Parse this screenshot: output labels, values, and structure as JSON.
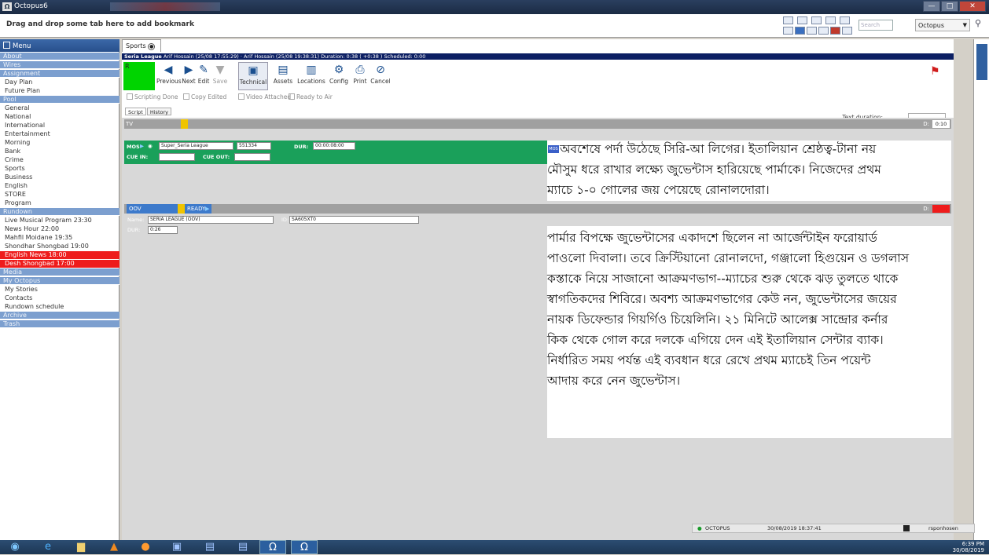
{
  "window": {
    "title": "Octopus6",
    "logo": "Ω",
    "minimize": "—",
    "maximize": "□",
    "close": "✕"
  },
  "bookmark_bar": {
    "hint": "Drag and drop some tab here to add bookmark",
    "search_placeholder": "Search",
    "site_select": "Octopus"
  },
  "sidebar": {
    "header": "Menu",
    "items": [
      {
        "label": "About",
        "kind": "sec"
      },
      {
        "label": "Wires",
        "kind": "sec"
      },
      {
        "label": "Assignment",
        "kind": "sec"
      },
      {
        "label": "Day Plan",
        "kind": "item"
      },
      {
        "label": "Future Plan",
        "kind": "item"
      },
      {
        "label": "Pool",
        "kind": "sec"
      },
      {
        "label": "General",
        "kind": "item"
      },
      {
        "label": "National",
        "kind": "item"
      },
      {
        "label": "International",
        "kind": "item"
      },
      {
        "label": "Entertainment",
        "kind": "item"
      },
      {
        "label": "Morning",
        "kind": "item"
      },
      {
        "label": "Bank",
        "kind": "item"
      },
      {
        "label": "Crime",
        "kind": "item"
      },
      {
        "label": "Sports",
        "kind": "item"
      },
      {
        "label": "Business",
        "kind": "item"
      },
      {
        "label": "English",
        "kind": "item"
      },
      {
        "label": "STORE",
        "kind": "item"
      },
      {
        "label": "Program",
        "kind": "item"
      },
      {
        "label": "Rundown",
        "kind": "sec"
      },
      {
        "label": "Live Musical Program 23:30",
        "kind": "item"
      },
      {
        "label": "News Hour 22:00",
        "kind": "item"
      },
      {
        "label": "Mahfil Moidane 19:35",
        "kind": "item"
      },
      {
        "label": "Shondhar Shongbad 19:00",
        "kind": "item"
      },
      {
        "label": "English News 18:00",
        "kind": "red"
      },
      {
        "label": "Desh Shongbad 17:00",
        "kind": "red"
      },
      {
        "label": "Media",
        "kind": "sec"
      },
      {
        "label": "My Octopus",
        "kind": "sec"
      },
      {
        "label": "My Stories",
        "kind": "item"
      },
      {
        "label": "Contacts",
        "kind": "item"
      },
      {
        "label": "Rundown schedule",
        "kind": "item"
      },
      {
        "label": "Archive",
        "kind": "sec"
      },
      {
        "label": "Trash",
        "kind": "sec"
      }
    ]
  },
  "tab": {
    "label": "Sports"
  },
  "story_info": {
    "title": "Seria League",
    "details": "Arif Hossain (25/08 17:55:29) · Arif Hossain (25/08 19:38:31) Duration: 0:38 ( +0:38 ) Scheduled: 0:00"
  },
  "toolbar": {
    "buttons": [
      {
        "label": "Previous",
        "icon": "◀",
        "state": "on"
      },
      {
        "label": "Next",
        "icon": "▶",
        "state": "on"
      },
      {
        "label": "Edit",
        "icon": "✎",
        "state": "on"
      },
      {
        "label": "Save",
        "icon": "▼",
        "state": "dis"
      },
      {
        "label": "Technical",
        "icon": "▣",
        "state": "act"
      },
      {
        "label": "Assets",
        "icon": "▤",
        "state": "on"
      },
      {
        "label": "Locations",
        "icon": "▥",
        "state": "on"
      },
      {
        "label": "Config",
        "icon": "⚙",
        "state": "on"
      },
      {
        "label": "Print",
        "icon": "⎙",
        "state": "on"
      },
      {
        "label": "Cancel",
        "icon": "⊘",
        "state": "on"
      }
    ]
  },
  "checkboxes": [
    "Scripting Done",
    "Copy Edited",
    "Video Attached",
    "Ready to Air"
  ],
  "text_duration_label": "Text duration:",
  "script_tabs": [
    "Script",
    "History"
  ],
  "tv_bar": {
    "label": "TV",
    "d_label": "D:",
    "time": "0:10"
  },
  "mos": {
    "tag": "MOS",
    "name": "Super_Seria League",
    "id": "551334",
    "dur_label": "DUR:",
    "dur": "00:00:08:00",
    "cue_in_label": "CUE IN:",
    "cue_out_label": "CUE OUT:"
  },
  "oov": {
    "label": "OOV",
    "ready": "READY",
    "d_label": "D:",
    "time": "0:28",
    "name_label": "Name:",
    "name": "SERIA LEAGUE (OOV)",
    "id_label": "ID:",
    "id": "SA605XT0",
    "dur_label": "DUR:",
    "dur": "0:26"
  },
  "script_block1": {
    "lines": [
      "অবশেষে পর্দা উঠেছে সিরি-আ লিগের। ইতালিয়ান শ্রেষ্ঠত্ব-টানা নয়",
      "মৌসুম ধরে রাখার লক্ষ্যে জুভেন্টাস হারিয়েছে পার্মাকে। নিজেদের প্রথম",
      "ম্যাচে ১-০ গোলের জয় পেয়েছে রোনালদোরা।"
    ]
  },
  "script_block2": {
    "lines": [
      "পার্মার বিপক্ষে জুভেন্টাসের একাদশে ছিলেন না আর্জেন্টাইন ফরোয়ার্ড",
      "পাওলো দিবালা। তবে ক্রিস্টিয়ানো রোনালদো, গঞ্জালো হিগুয়েন ও ডগলাস",
      "কস্তাকে নিয়ে সাজানো আক্রমণভাগ--ম্যাচের শুরু থেকে ঝড় তুলতে থাকে",
      "স্বাগতিকদের শিবিরে। অবশ্য আক্রমণভাগের কেউ নন, জুভেন্টাসের জয়ের",
      "নায়ক ডিফেন্ডার গিয়র্গিও চিয়েলিনি। ২১ মিনিটে আলেক্স সান্দ্রোর কর্নার",
      "কিক থেকে গোল করে দলকে এগিয়ে দেন এই ইতালিয়ান সেন্টার ব্যাক।",
      "নির্ধারিত সময় পর্যন্ত এই ব্যবধান ধরে রেখে প্রথম ম্যাচেই তিন পয়েন্ট",
      "আদায় করে নেন জুভেন্টাস।"
    ]
  },
  "status": {
    "server": "OCTOPUS",
    "datetime": "30/08/2019 18:37:41",
    "user": "rsponhosen"
  },
  "taskbar": {
    "clock": "6:39 PM",
    "date": "30/08/2019"
  }
}
